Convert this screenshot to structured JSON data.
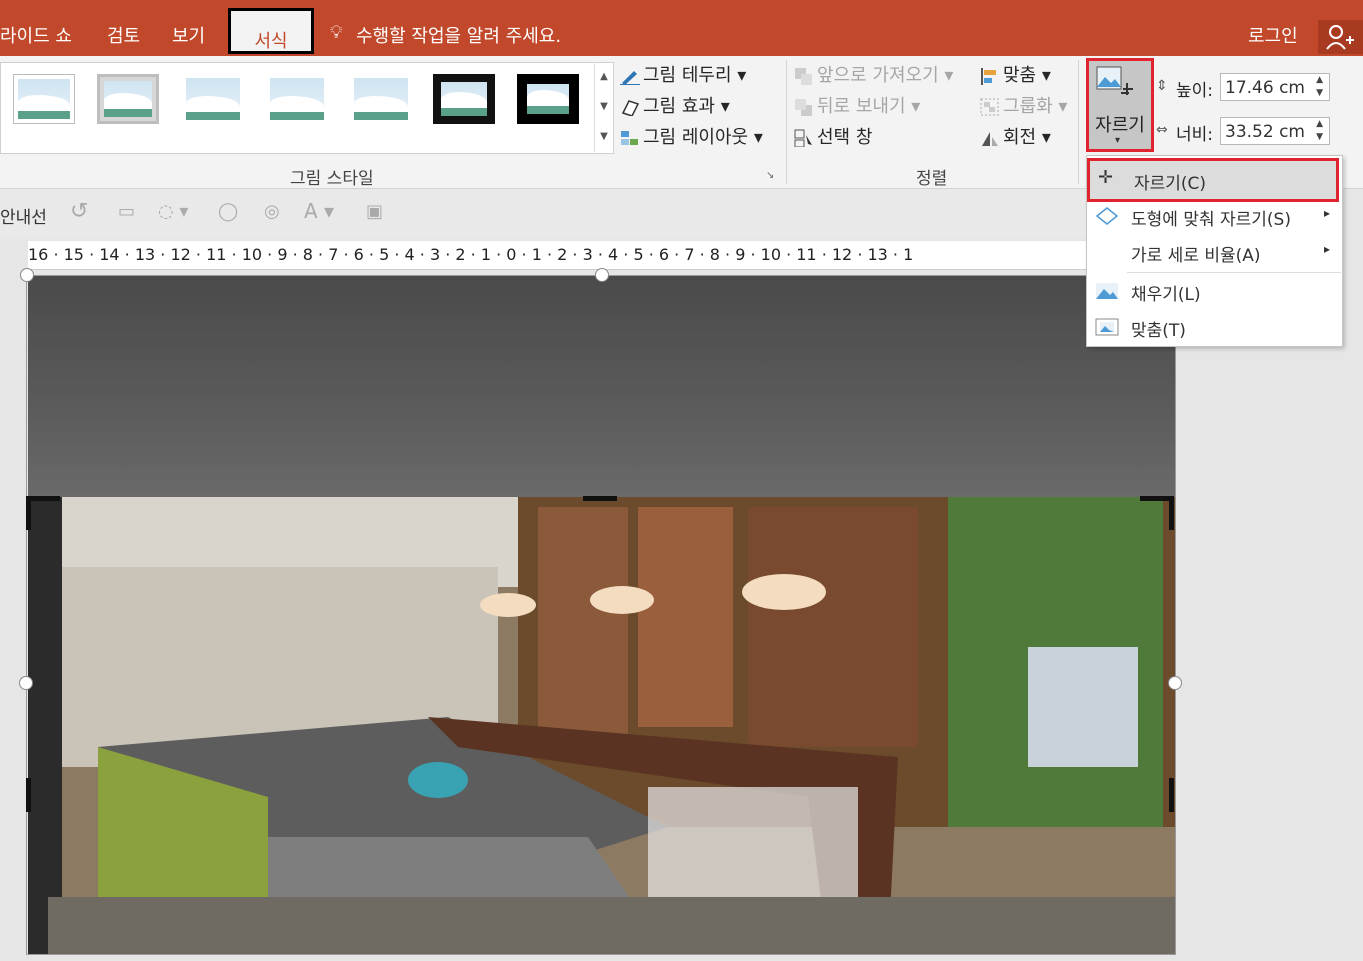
{
  "tabs": {
    "slideshow": "라이드 쇼",
    "review": "검토",
    "view": "보기",
    "format": "서식",
    "tellme": "수행할 작업을 알려 주세요.",
    "login": "로그인"
  },
  "ribbon": {
    "picture_styles_group": "그림 스타일",
    "border": "그림 테두리",
    "effects": "그림 효과",
    "layout": "그림 레이아웃",
    "arrange_group": "정렬",
    "bring_forward": "앞으로 가져오기",
    "send_backward": "뒤로 보내기",
    "selection_pane": "선택 창",
    "align": "맞춤",
    "group": "그룹화",
    "rotate": "회전",
    "crop": "자르기",
    "height_label": "높이:",
    "height_value": "17.46 cm",
    "width_label": "너비:",
    "width_value": "33.52 cm"
  },
  "qat": {
    "guides": "안내선"
  },
  "ruler": "16 · 15 · 14 · 13 · 12 · 11 · 10 · 9 · 8 · 7 · 6 · 5 · 4 · 3 · 2 · 1 · 0 · 1 · 2 · 3 · 4 · 5 · 6 · 7 · 8 · 9 · 10 · 11 · 12 · 13 · 1",
  "menu": {
    "crop": "자르기(C)",
    "crop_to_shape": "도형에 맞춰 자르기(S)",
    "aspect_ratio": "가로 세로 비율(A)",
    "fill": "채우기(L)",
    "fit": "맞춤(T)"
  },
  "colors": {
    "accent": "#c2482b",
    "highlight": "#e0242e"
  }
}
